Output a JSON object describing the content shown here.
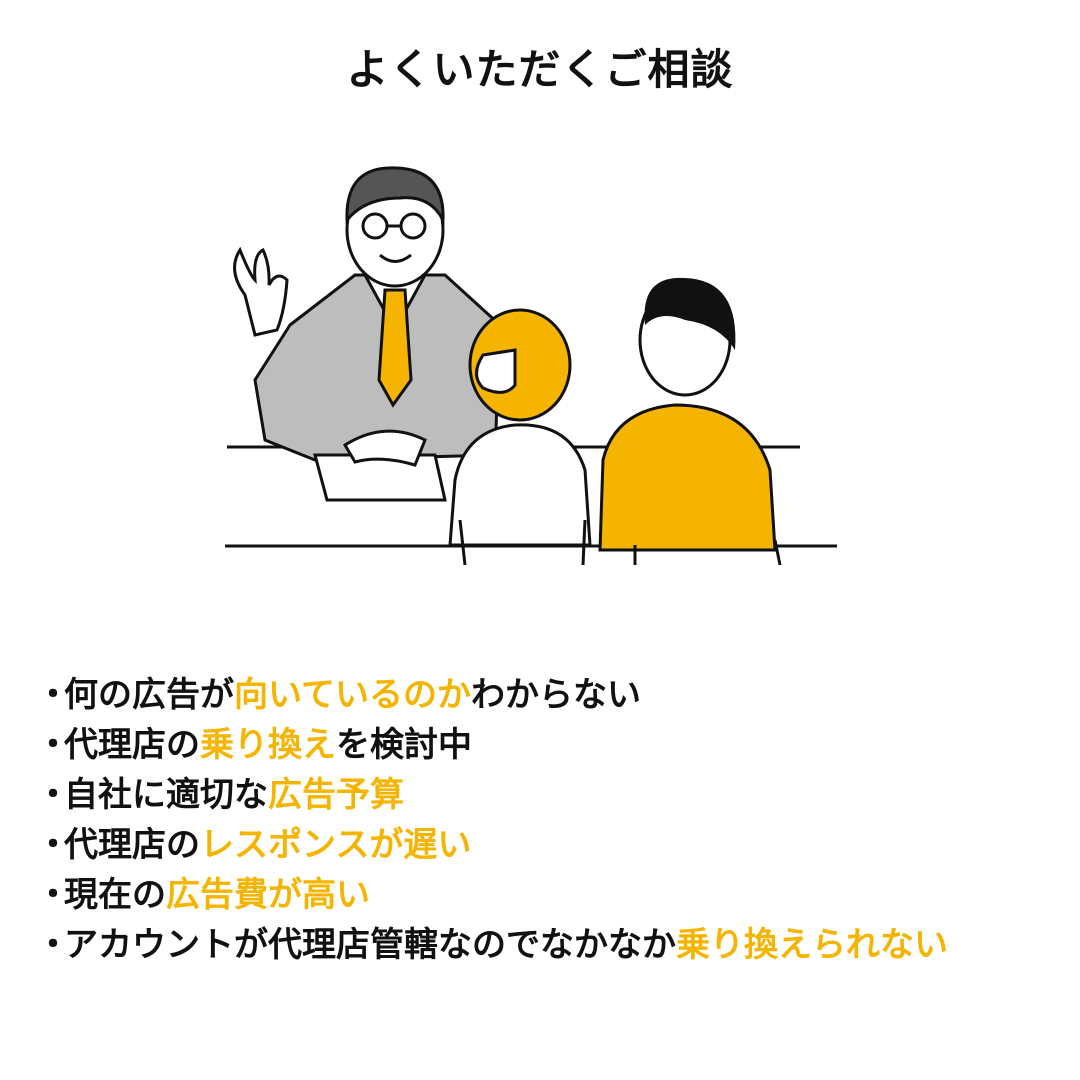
{
  "title": "よくいただくご相談",
  "accent_color": "#F5B400",
  "bullet": "・",
  "items": [
    {
      "segments": [
        {
          "text": "何の広告が",
          "hl": false
        },
        {
          "text": "向いているのか",
          "hl": true
        },
        {
          "text": "わからない",
          "hl": false
        }
      ]
    },
    {
      "segments": [
        {
          "text": "代理店の",
          "hl": false
        },
        {
          "text": "乗り換え",
          "hl": true
        },
        {
          "text": "を検討中",
          "hl": false
        }
      ]
    },
    {
      "segments": [
        {
          "text": "自社に適切な",
          "hl": false
        },
        {
          "text": "広告予算",
          "hl": true
        }
      ]
    },
    {
      "segments": [
        {
          "text": "代理店の",
          "hl": false
        },
        {
          "text": "レスポンスが遅い",
          "hl": true
        }
      ]
    },
    {
      "segments": [
        {
          "text": "現在の",
          "hl": false
        },
        {
          "text": "広告費が高い",
          "hl": true
        }
      ]
    },
    {
      "segments": [
        {
          "text": "アカウントが代理店管轄なのでなかなか",
          "hl": false
        },
        {
          "text": "乗り換えられない",
          "hl": true
        }
      ]
    }
  ]
}
